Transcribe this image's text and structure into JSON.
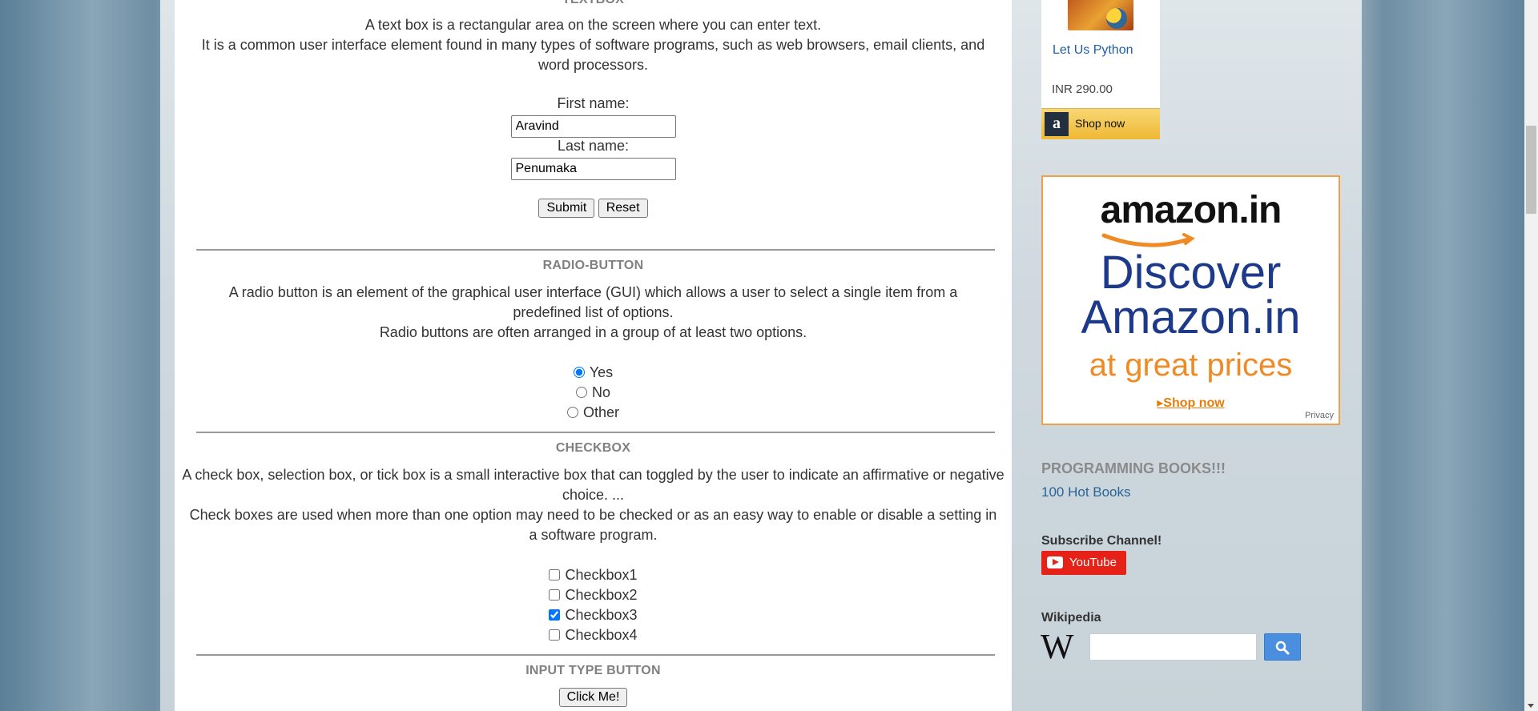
{
  "textbox": {
    "title": "TEXTBOX",
    "para1": "A text box is a rectangular area on the screen where you can enter text.",
    "para2": "It is a common user interface element found in many types of software programs, such as web browsers, email clients, and word processors.",
    "first_label": "First name:",
    "first_value": "Aravind",
    "last_label": "Last name:",
    "last_value": "Penumaka",
    "submit_label": "Submit",
    "reset_label": "Reset"
  },
  "radio": {
    "title": "RADIO-BUTTON",
    "para1": "A radio button is an element of the graphical user interface (GUI) which allows a user to select a single item from a predefined list of options.",
    "para2": "Radio buttons are often arranged in a group of at least two options.",
    "options": [
      {
        "label": "Yes",
        "checked": true
      },
      {
        "label": "No",
        "checked": false
      },
      {
        "label": "Other",
        "checked": false
      }
    ]
  },
  "checkbox": {
    "title": "CHECKBOX",
    "para1": "A check box, selection box, or tick box is a small interactive box that can toggled by the user to indicate an affirmative or negative choice. ...",
    "para2": "Check boxes are used when more than one option may need to be checked or as an easy way to enable or disable a setting in a software program.",
    "options": [
      {
        "label": "Checkbox1",
        "checked": false
      },
      {
        "label": "Checkbox2",
        "checked": false
      },
      {
        "label": "Checkbox3",
        "checked": true
      },
      {
        "label": "Checkbox4",
        "checked": false
      }
    ]
  },
  "input_button": {
    "title": "INPUT TYPE BUTTON",
    "button_label": "Click Me!"
  },
  "sidebar": {
    "product_title": "Let Us Python",
    "product_price": "INR 290.00",
    "shop_now": "Shop now",
    "banner": {
      "brand": "amazon.in",
      "line1": "Discover",
      "line2": "Amazon.in",
      "line3": "at great prices",
      "cta": "Shop now",
      "privacy": "Privacy"
    },
    "books_heading": "PROGRAMMING BOOKS!!!",
    "books_link": "100 Hot Books",
    "subscribe_heading": "Subscribe Channel!",
    "youtube_label": "YouTube",
    "wikipedia_heading": "Wikipedia",
    "wikipedia_search_value": ""
  },
  "colors": {
    "accent_link": "#1f5fa8",
    "youtube_red": "#e62117",
    "search_blue": "#4a8ee0",
    "amazon_orange": "#f08a24"
  }
}
